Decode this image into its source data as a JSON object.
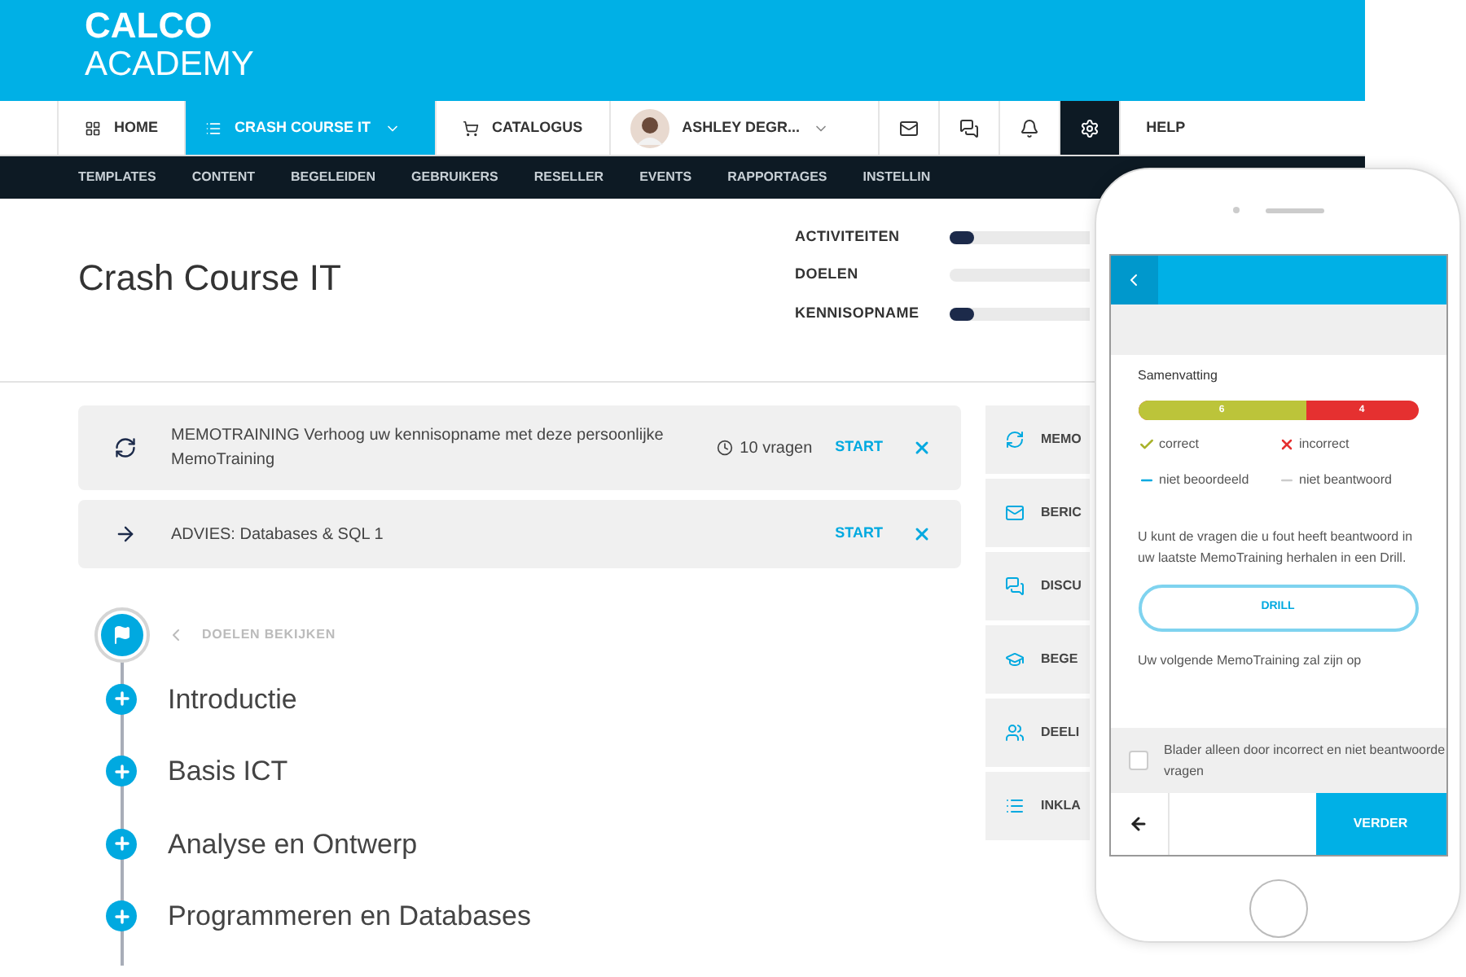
{
  "brand": {
    "line_1": "CALCO",
    "line_2": "ACADEMY"
  },
  "nav": [
    {
      "kind": "link",
      "label": "HOME",
      "selected": false
    },
    {
      "kind": "dropdown",
      "label": "CRASH COURSE IT",
      "selected": true
    },
    {
      "kind": "link",
      "label": "CATALOGUS",
      "selected": false
    },
    {
      "kind": "user",
      "label": "ASHLEY DEGR...",
      "selected": false
    },
    {
      "kind": "mail",
      "selected": false
    },
    {
      "kind": "chat",
      "selected": false
    },
    {
      "kind": "bell",
      "selected": false
    },
    {
      "kind": "gear",
      "selected": true
    },
    {
      "kind": "link",
      "label": "HELP",
      "selected": false
    }
  ],
  "subnav": [
    "TEMPLATES",
    "CONTENT",
    "BEGELEIDEN",
    "GEBRUIKERS",
    "RESELLER",
    "EVENTS",
    "RAPPORTAGES",
    "INSTELLIN"
  ],
  "course": {
    "title": "Crash Course IT",
    "progress": [
      {
        "label": "ACTIVITEITEN",
        "level": 0.17
      },
      {
        "label": "DOELEN"
      },
      {
        "label": "KENNISOPNAME",
        "level": 0.17
      }
    ]
  },
  "tasks": [
    {
      "kind": "memo",
      "title": "MEMOTRAINING",
      "text": "Verhoog uw kennisopname met deze persoonlijke MemoTraining",
      "count": "10 vragen",
      "action": "START"
    },
    {
      "kind": "advice",
      "title": "ADVIES:",
      "text": "Databases & SQL 1",
      "action": "START"
    }
  ],
  "goals": {
    "back": "DOELEN BEKIJKEN",
    "items": [
      "Introductie",
      "Basis ICT",
      "Analyse en Ontwerp",
      "Programmeren en Databases"
    ]
  },
  "side_menu": [
    "MEMO",
    "BERIC",
    "DISCU",
    "BEGE",
    "DEELI",
    "INKLA"
  ],
  "phone": {
    "summary_title": "Samenvatting",
    "score": {
      "correct": "6",
      "incorrect": "4",
      "level": 0.6
    },
    "legend": [
      {
        "kind": "check",
        "label": "correct"
      },
      {
        "kind": "cross",
        "label": "incorrect"
      },
      {
        "kind": "blue-dash",
        "label": "niet beoordeeld"
      },
      {
        "kind": "grey-dash",
        "label": "niet beantwoord"
      }
    ],
    "info": "U kunt de vragen die u fout heeft beantwoord in uw laatste MemoTraining herhalen in een Drill.",
    "drill": "DRILL",
    "next": "Uw volgende MemoTraining zal zijn op",
    "filter": {
      "label": "Blader alleen door incorrect en niet beantwoorde vragen",
      "checked": false
    },
    "continue": "VERDER"
  }
}
